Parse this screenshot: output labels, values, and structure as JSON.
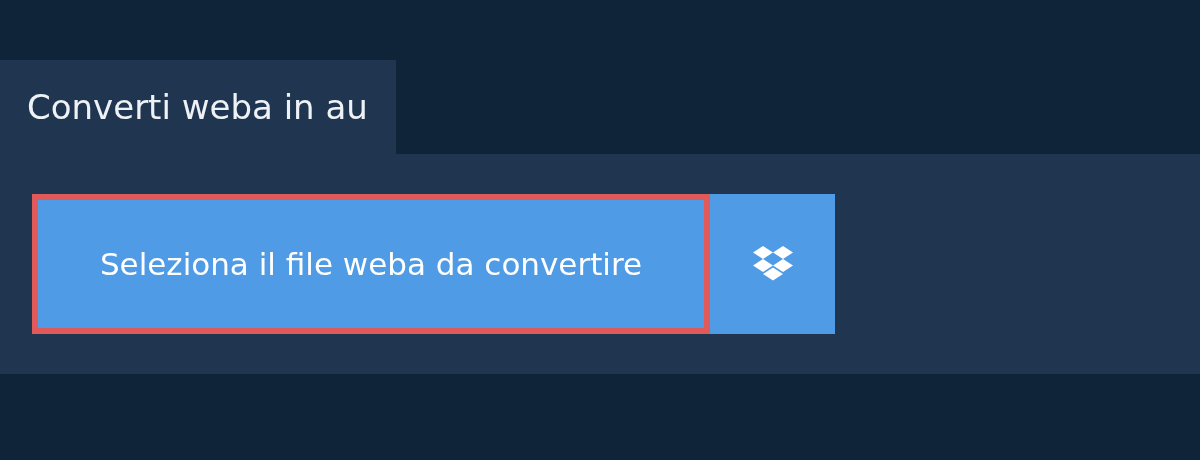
{
  "tab": {
    "label": "Converti weba in au",
    "selected": true
  },
  "upload_button": {
    "label": "Seleziona il file weba da convertire",
    "focused": true
  },
  "dropbox_button": {
    "kind": "dropbox"
  }
}
